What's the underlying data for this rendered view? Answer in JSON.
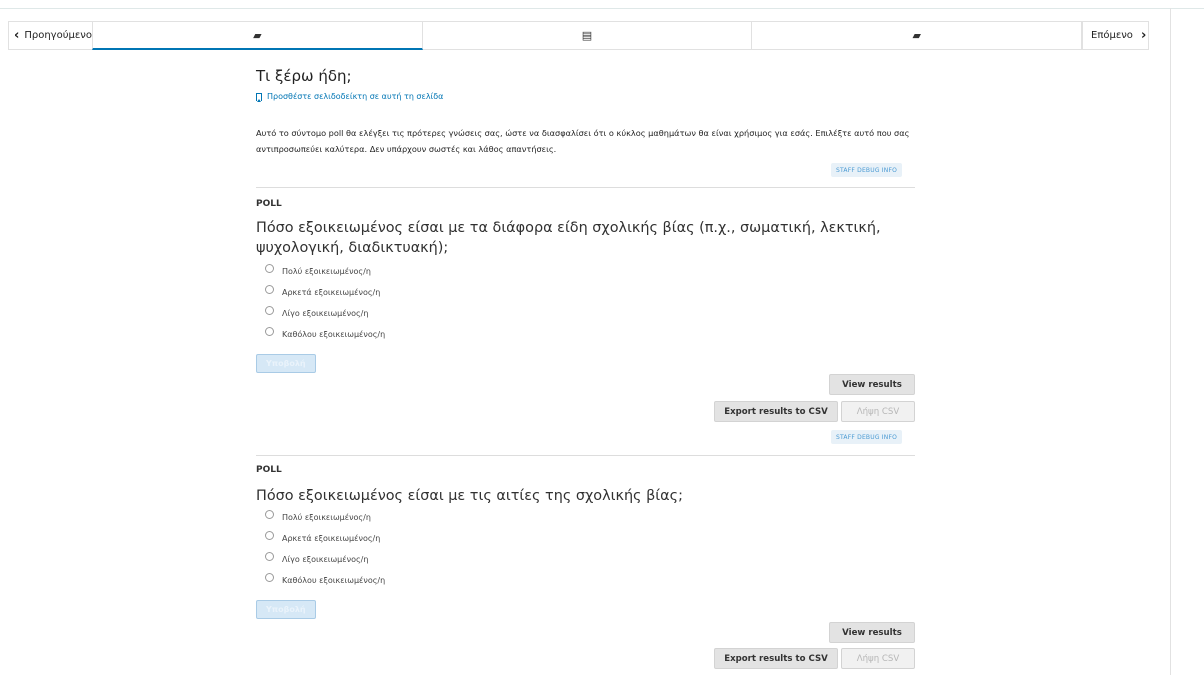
{
  "nav": {
    "prev_label": "Προηγούμενο",
    "next_label": "Επόμενο",
    "prev_icon": "chevron-left-icon",
    "next_icon": "chevron-right-icon",
    "tabs": [
      {
        "icon": "book-icon",
        "glyph": "▰",
        "active": true
      },
      {
        "icon": "video-icon",
        "glyph": "▤",
        "active": false
      },
      {
        "icon": "book-icon",
        "glyph": "▰",
        "active": false
      }
    ]
  },
  "unit": {
    "title": "Τι ξέρω ήδη;",
    "bookmark_label": "Προσθέστε σελιδοδείκτη σε αυτή τη σελίδα",
    "bookmark_icon": "bookmark-icon",
    "intro": "Αυτό το σύντομο poll θα ελέγξει τις πρότερες γνώσεις σας, ώστε να διασφαλίσει ότι ο κύκλος μαθημάτων θα είναι χρήσιμος για εσάς. Επιλέξτε αυτό που σας αντιπροσωπεύει καλύτερα. Δεν υπάρχουν σωστές και λάθος απαντήσεις."
  },
  "debug_label": "STAFF DEBUG INFO",
  "polls": [
    {
      "label": "POLL",
      "question": "Πόσο εξοικειωμένος είσαι με τα διάφορα είδη σχολικής βίας (π.χ., σωματική, λεκτική, ψυχολογική, διαδικτυακή);",
      "options": [
        "Πολύ εξοικειωμένος/η",
        "Αρκετά εξοικειωμένος/η",
        "Λίγο εξοικειωμένος/η",
        "Καθόλου εξοικειωμένος/η"
      ],
      "submit_label": "Υποβολή",
      "view_results_label": "View results",
      "export_label": "Export results to CSV",
      "download_label": "Λήψη CSV"
    },
    {
      "label": "POLL",
      "question": "Πόσο εξοικειωμένος είσαι με τις αιτίες της σχολικής βίας;",
      "options": [
        "Πολύ εξοικειωμένος/η",
        "Αρκετά εξοικειωμένος/η",
        "Λίγο εξοικειωμένος/η",
        "Καθόλου εξοικειωμένος/η"
      ],
      "submit_label": "Υποβολή",
      "view_results_label": "View results",
      "export_label": "Export results to CSV",
      "download_label": "Λήψη CSV"
    }
  ],
  "colors": {
    "accent": "#0075b4",
    "debug_bg": "#e8f1f8",
    "button_gray": "#e3e3e3"
  }
}
